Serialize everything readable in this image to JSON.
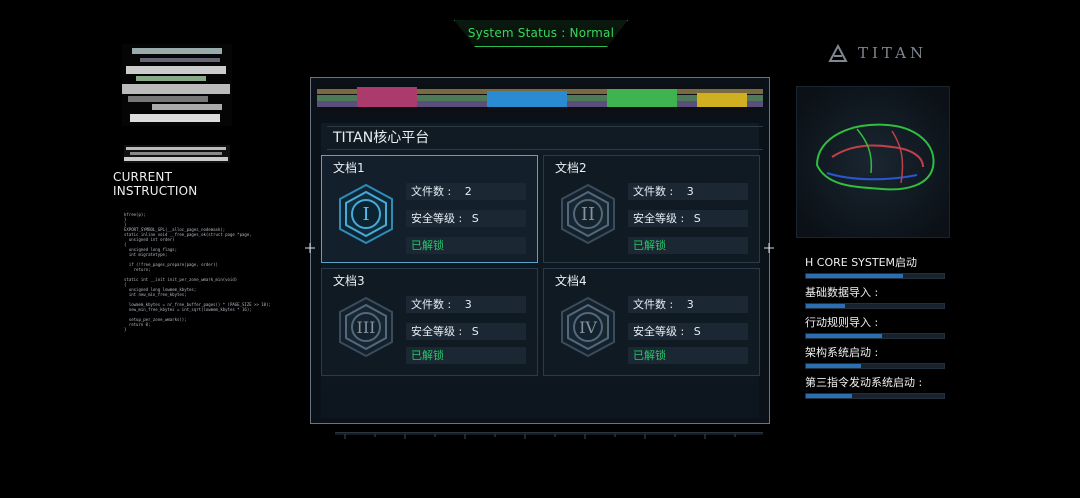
{
  "header": {
    "status_text": "System Status : Normal"
  },
  "left_panel": {
    "current_instruction_label": "CURRENT INSTRUCTION",
    "code_text": "kfree(p);\n}\n}\nEXPORT_SYMBOL_GPL(__alloc_pages_nodemask);\nstatic inline void __free_pages_ok(struct page *page,\n  unsigned int order)\n{\n  unsigned long flags;\n  int migratetype;\n\n  if (!free_pages_prepare(page, order))\n    return;\n\nstatic int __init init_per_zone_wmark_min(void)\n{\n  unsigned long lowmem_kbytes;\n  int new_min_free_kbytes;\n\n  lowmem_kbytes = nr_free_buffer_pages() * (PAGE_SIZE >> 10);\n  new_min_free_kbytes = int_sqrt(lowmem_kbytes * 16);\n\n  setup_per_zone_wmarks();\n  return 0;\n}\n"
  },
  "right_panel": {
    "brand": "TITAN",
    "section_title": "H CORE SYSTEM启动",
    "items": [
      {
        "label": "基础数据导入 :",
        "progress": 0.28
      },
      {
        "label": "行动规则导入 :",
        "progress": 0.55
      },
      {
        "label": "架构系统启动 :",
        "progress": 0.4
      },
      {
        "label": "第三指令发动系统启动 :",
        "progress": 0.33
      }
    ],
    "accent_color": "#2b6fb0"
  },
  "main": {
    "title": "TITAN核心平台",
    "cards": [
      {
        "name": "文档1",
        "numeral": "I",
        "count_label": "文件数 :",
        "count": "2",
        "security_label": "安全等级 :",
        "security": "S",
        "status": "已解锁",
        "active": true
      },
      {
        "name": "文档2",
        "numeral": "II",
        "count_label": "文件数 :",
        "count": "3",
        "security_label": "安全等级 :",
        "security": "S",
        "status": "已解锁",
        "active": false
      },
      {
        "name": "文档3",
        "numeral": "III",
        "count_label": "文件数 :",
        "count": "3",
        "security_label": "安全等级 :",
        "security": "S",
        "status": "已解锁",
        "active": false
      },
      {
        "name": "文档4",
        "numeral": "IV",
        "count_label": "文件数 :",
        "count": "3",
        "security_label": "安全等级 :",
        "security": "S",
        "status": "已解锁",
        "active": false
      }
    ],
    "unlock_color": "#27c86a",
    "active_color": "#5aa3c8"
  }
}
